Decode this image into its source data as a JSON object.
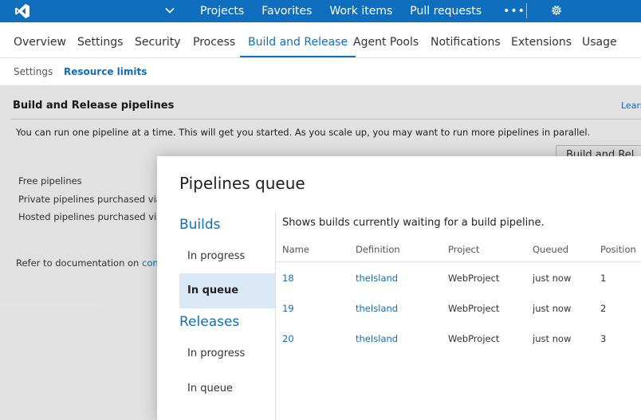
{
  "colors": {
    "brand": "#106ebe",
    "selected_bg": "#dbe9f7"
  },
  "topbar": {
    "items": [
      "Projects",
      "Favorites",
      "Work items",
      "Pull requests"
    ],
    "more": "•••"
  },
  "nav2": {
    "tabs": [
      "Overview",
      "Settings",
      "Security",
      "Process",
      "Build and Release",
      "Agent Pools",
      "Notifications",
      "Extensions",
      "Usage"
    ],
    "active": "Build and Release"
  },
  "nav3": {
    "items": [
      "Settings",
      "Resource limits"
    ],
    "active": "Resource limits"
  },
  "main": {
    "section_title": "Build and Release pipelines",
    "learn_link": "Learn",
    "description": "You can run one pipeline at a time. This will get you started. As you scale up, you may want to run more pipelines in parallel.",
    "background_button": "Build and Rel",
    "rows": [
      "Free pipelines",
      "Private pipelines purchased via th",
      "Hosted pipelines purchased via th"
    ],
    "refer_text": "Refer to documentation on ",
    "refer_link": "concu"
  },
  "dialog": {
    "title": "Pipelines queue",
    "builds_header": "Builds",
    "builds_items": [
      "In progress",
      "In queue"
    ],
    "releases_header": "Releases",
    "releases_items": [
      "In progress",
      "In queue"
    ],
    "intro": "Shows builds currently waiting for a build pipeline.",
    "columns": [
      "Name",
      "Definition",
      "Project",
      "Queued",
      "Position"
    ],
    "rows": [
      {
        "name": "18",
        "definition": "theIsland",
        "project": "WebProject",
        "queued": "just now",
        "position": "1"
      },
      {
        "name": "19",
        "definition": "theIsland",
        "project": "WebProject",
        "queued": "just now",
        "position": "2"
      },
      {
        "name": "20",
        "definition": "theIsland",
        "project": "WebProject",
        "queued": "just now",
        "position": "3"
      }
    ]
  }
}
